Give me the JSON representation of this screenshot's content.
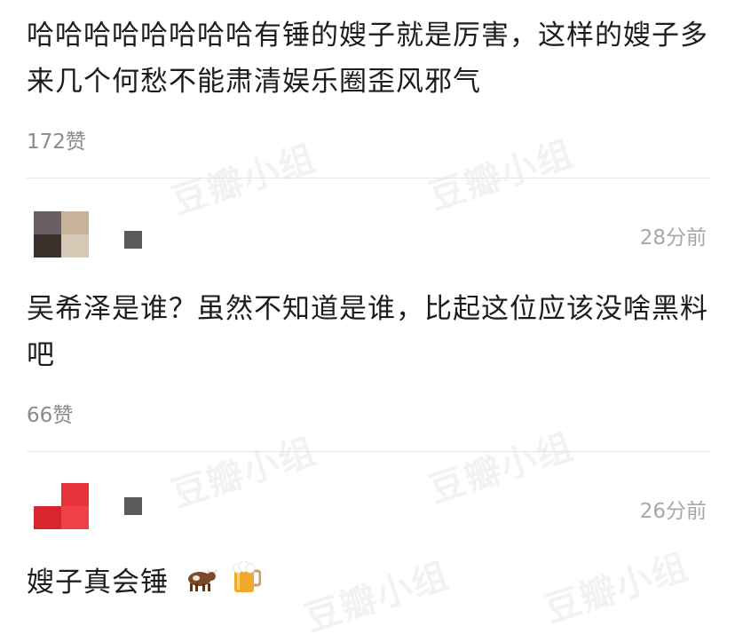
{
  "watermark": {
    "text": "豆瓣小组"
  },
  "comments": [
    {
      "text": "哈哈哈哈哈哈哈哈有锤的嫂子就是厉害，这样的嫂子多来几个何愁不能肃清娱乐圈歪风邪气",
      "likes": "172赞"
    },
    {
      "time": "28分前",
      "text": "吴希泽是谁？虽然不知道是谁，比起这位应该没啥黑料吧",
      "likes": "66赞"
    },
    {
      "time": "26分前",
      "text": "嫂子真会锤",
      "emoji": [
        "cow-icon",
        "beer-mug-icon"
      ]
    }
  ]
}
